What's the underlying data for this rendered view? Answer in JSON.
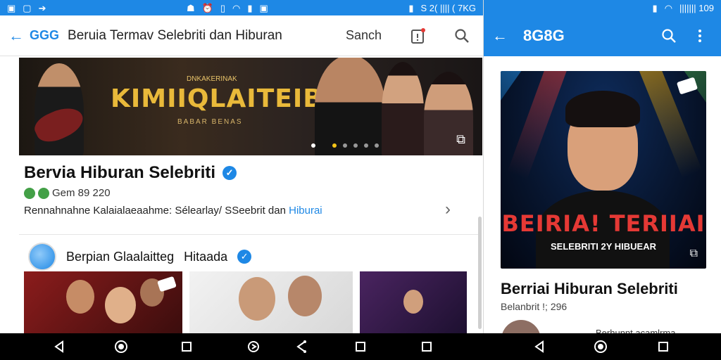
{
  "left": {
    "status": {
      "time": "",
      "right_text": ""
    },
    "appbar": {
      "logo": "GGG",
      "title": "Beruia Termav Selebriti dan Hiburan",
      "search_label": "Sanch"
    },
    "banner": {
      "kicker": "DNKAKERINAK",
      "title": "KIMIIQLAITEIBIAN",
      "subtitle": "BABAR BENAS"
    },
    "channel": {
      "name": "Bervia Hiburan Selebriti",
      "meta": "Gem 89 220",
      "description": "Rennahnahne Kalaialaeaahme: Sélearlay/ SSeebrit dan",
      "description_link": "Hiburai"
    },
    "row2": {
      "name": "Berpian Glaalaitteg",
      "name_suffix": "Hitaada"
    }
  },
  "right": {
    "status": {
      "text": "S 2(  ||||| ( 7KG"
    },
    "appbar": {
      "logo": "8G8G"
    },
    "card": {
      "title": "BEIRIA! TERIIAI",
      "subtitle": "SELEBRITI 2Y HIBUEAR"
    },
    "title": "Berriai Hiburan Selebriti",
    "meta": "Belanbrit !; 296",
    "more_text": "Berhunnt acamlrma"
  },
  "status_left_text": "S 2( |||| ( 7KG",
  "status_right_text": "||||||| 109",
  "colors": {
    "accent": "#1e88e5",
    "banner_gold": "#e9b93a",
    "card_red": "#e53935",
    "verified": "#1e88e5",
    "nav_bg": "#000000"
  },
  "icons": {
    "back": "arrow-left-icon",
    "search": "search-icon",
    "notification": "notification-icon",
    "more": "more-vert-icon",
    "verified": "verified-check-icon",
    "chevron": "chevron-right-icon",
    "nav_back": "nav-back-icon",
    "nav_home": "nav-home-icon",
    "nav_recents": "nav-recents-icon"
  }
}
